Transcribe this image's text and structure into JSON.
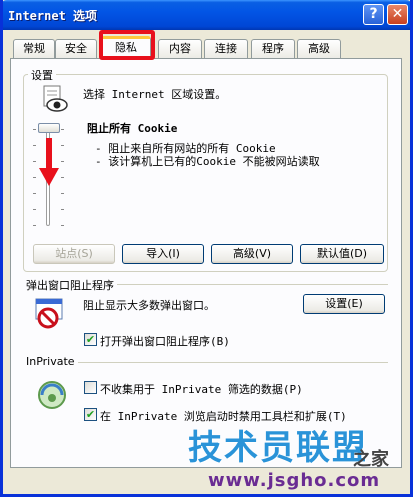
{
  "window": {
    "title": "Internet 选项",
    "help": "?",
    "close": "✕"
  },
  "tabs": [
    {
      "label": "常规"
    },
    {
      "label": "安全"
    },
    {
      "label": "隐私"
    },
    {
      "label": "内容"
    },
    {
      "label": "连接"
    },
    {
      "label": "程序"
    },
    {
      "label": "高级"
    }
  ],
  "settings": {
    "legend": "设置",
    "instruction": "选择 Internet 区域设置。",
    "level_title": "阻止所有 Cookie",
    "desc1": "- 阻止来自所有网站的所有 Cookie",
    "desc2": "- 该计算机上已有的Cookie 不能被网站读取",
    "slider_level": 1.0,
    "buttons": {
      "sites": "站点(S)",
      "import": "导入(I)",
      "advanced": "高级(V)",
      "default": "默认值(D)"
    }
  },
  "popup": {
    "legend": "弹出窗口阻止程序",
    "desc": "阻止显示大多数弹出窗口。",
    "settings_button": "设置(E)",
    "enable_label": "打开弹出窗口阻止程序(B)",
    "enable_checked": true
  },
  "inprivate": {
    "legend": "InPrivate",
    "no_collect_label": "不收集用于 InPrivate 筛选的数据(P)",
    "no_collect_checked": false,
    "disable_toolbars_label": "在 InPrivate 浏览启动时禁用工具栏和扩展(T)",
    "disable_toolbars_checked": true
  },
  "watermark": {
    "main": "技术员联盟",
    "suffix": "之家",
    "url": "www.jsgho.com"
  },
  "colors": {
    "highlight": "#e8101c",
    "xp_blue": "#0255e5"
  }
}
